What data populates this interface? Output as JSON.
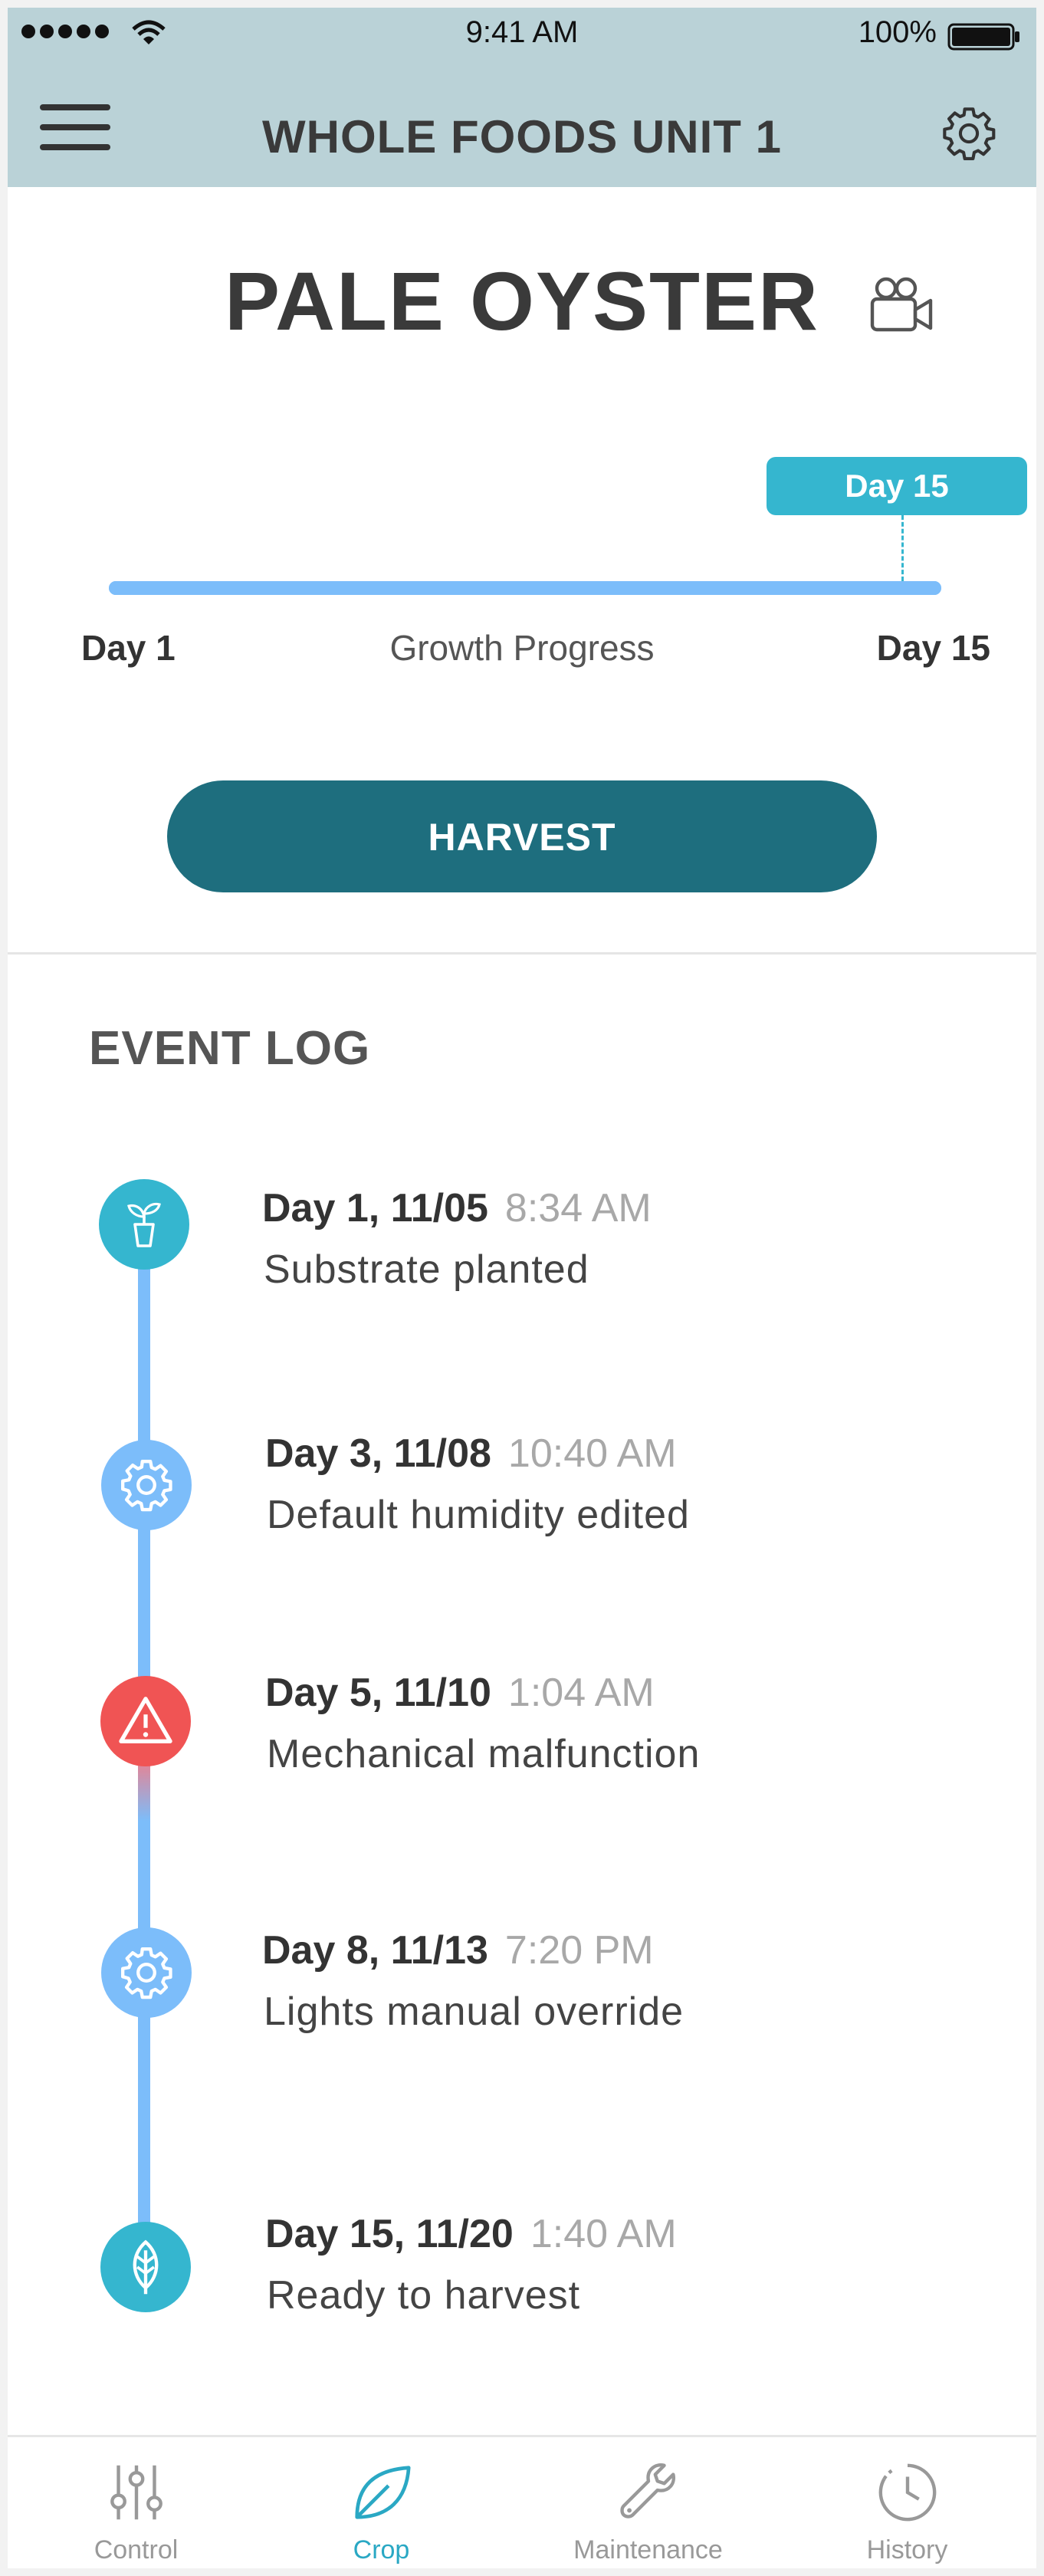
{
  "status_bar": {
    "time": "9:41 AM",
    "battery": "100%"
  },
  "header": {
    "title": "WHOLE FOODS UNIT 1"
  },
  "crop": {
    "name": "PALE OYSTER"
  },
  "progress": {
    "current_tag": "Day 15",
    "start_label": "Day 1",
    "center_label": "Growth Progress",
    "end_label": "Day 15",
    "fraction": 1.0
  },
  "harvest_label": "HARVEST",
  "event_log": {
    "title": "EVENT LOG",
    "events": [
      {
        "date": "Day 1, 11/05",
        "time": "8:34 AM",
        "description": "Substrate planted",
        "icon": "plant-pot-icon",
        "color": "#35b6cf"
      },
      {
        "date": "Day 3, 11/08",
        "time": "10:40 AM",
        "description": "Default humidity edited",
        "icon": "gear-icon",
        "color": "#7cbdfa"
      },
      {
        "date": "Day 5, 11/10",
        "time": "1:04 AM",
        "description": "Mechanical malfunction",
        "icon": "warning-icon",
        "color": "#f05454"
      },
      {
        "date": "Day 8, 11/13",
        "time": "7:20 PM",
        "description": "Lights manual override",
        "icon": "gear-icon",
        "color": "#7cbdfa"
      },
      {
        "date": "Day 15, 11/20",
        "time": "1:40 AM",
        "description": "Ready to harvest",
        "icon": "leaf-icon",
        "color": "#35b6cf"
      }
    ]
  },
  "tabs": [
    {
      "label": "Control",
      "icon": "sliders-icon"
    },
    {
      "label": "Crop",
      "icon": "leaf-icon",
      "active": true
    },
    {
      "label": "Maintenance",
      "icon": "wrench-icon"
    },
    {
      "label": "History",
      "icon": "clock-icon"
    }
  ],
  "colors": {
    "header_bg": "#bad2d7",
    "accent": "#35b6cf",
    "harvest": "#1e6e7e",
    "progress": "#7cbdfa",
    "alert": "#f05454"
  }
}
